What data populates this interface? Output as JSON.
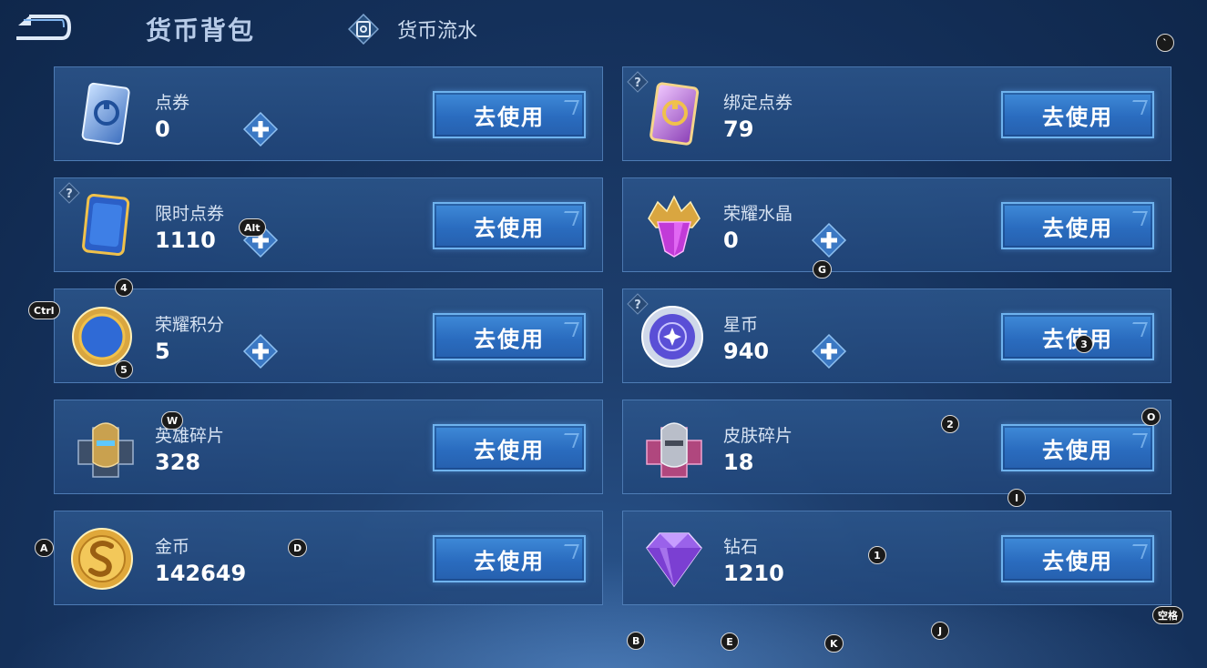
{
  "header": {
    "title": "货币背包",
    "flow_tab_label": "货币流水"
  },
  "action_label": "去使用",
  "currencies": [
    {
      "name": "点券",
      "amount": "0",
      "icon": "blue-ticket-icon",
      "has_plus": true,
      "has_help": false
    },
    {
      "name": "绑定点券",
      "amount": "79",
      "icon": "purple-ticket-icon",
      "has_plus": false,
      "has_help": true
    },
    {
      "name": "限时点券",
      "amount": "1110",
      "icon": "limited-time-ticket-icon",
      "has_plus": true,
      "has_help": true
    },
    {
      "name": "荣耀水晶",
      "amount": "0",
      "icon": "glory-crystal-icon",
      "has_plus": true,
      "has_help": false
    },
    {
      "name": "荣耀积分",
      "amount": "5",
      "icon": "glory-points-coin-icon",
      "has_plus": true,
      "has_help": false
    },
    {
      "name": "星币",
      "amount": "940",
      "icon": "star-coin-icon",
      "has_plus": true,
      "has_help": true
    },
    {
      "name": "英雄碎片",
      "amount": "328",
      "icon": "hero-fragment-icon",
      "has_plus": false,
      "has_help": false
    },
    {
      "name": "皮肤碎片",
      "amount": "18",
      "icon": "skin-fragment-icon",
      "has_plus": false,
      "has_help": false
    },
    {
      "name": "金币",
      "amount": "142649",
      "icon": "gold-coin-icon",
      "has_plus": false,
      "has_help": false
    },
    {
      "name": "钻石",
      "amount": "1210",
      "icon": "diamond-icon",
      "has_plus": false,
      "has_help": false
    }
  ],
  "key_hints": [
    "`",
    "Alt",
    "4",
    "Ctrl",
    "5",
    "G",
    "3",
    "W",
    "2",
    "O",
    "I",
    "A",
    "D",
    "1",
    "空格",
    "B",
    "E",
    "K",
    "J"
  ],
  "colors": {
    "background": "#14305a",
    "card": "#2a5288",
    "button": "#2f78cc",
    "button_border": "#6fb3ee",
    "title": "#b7cbe8"
  }
}
